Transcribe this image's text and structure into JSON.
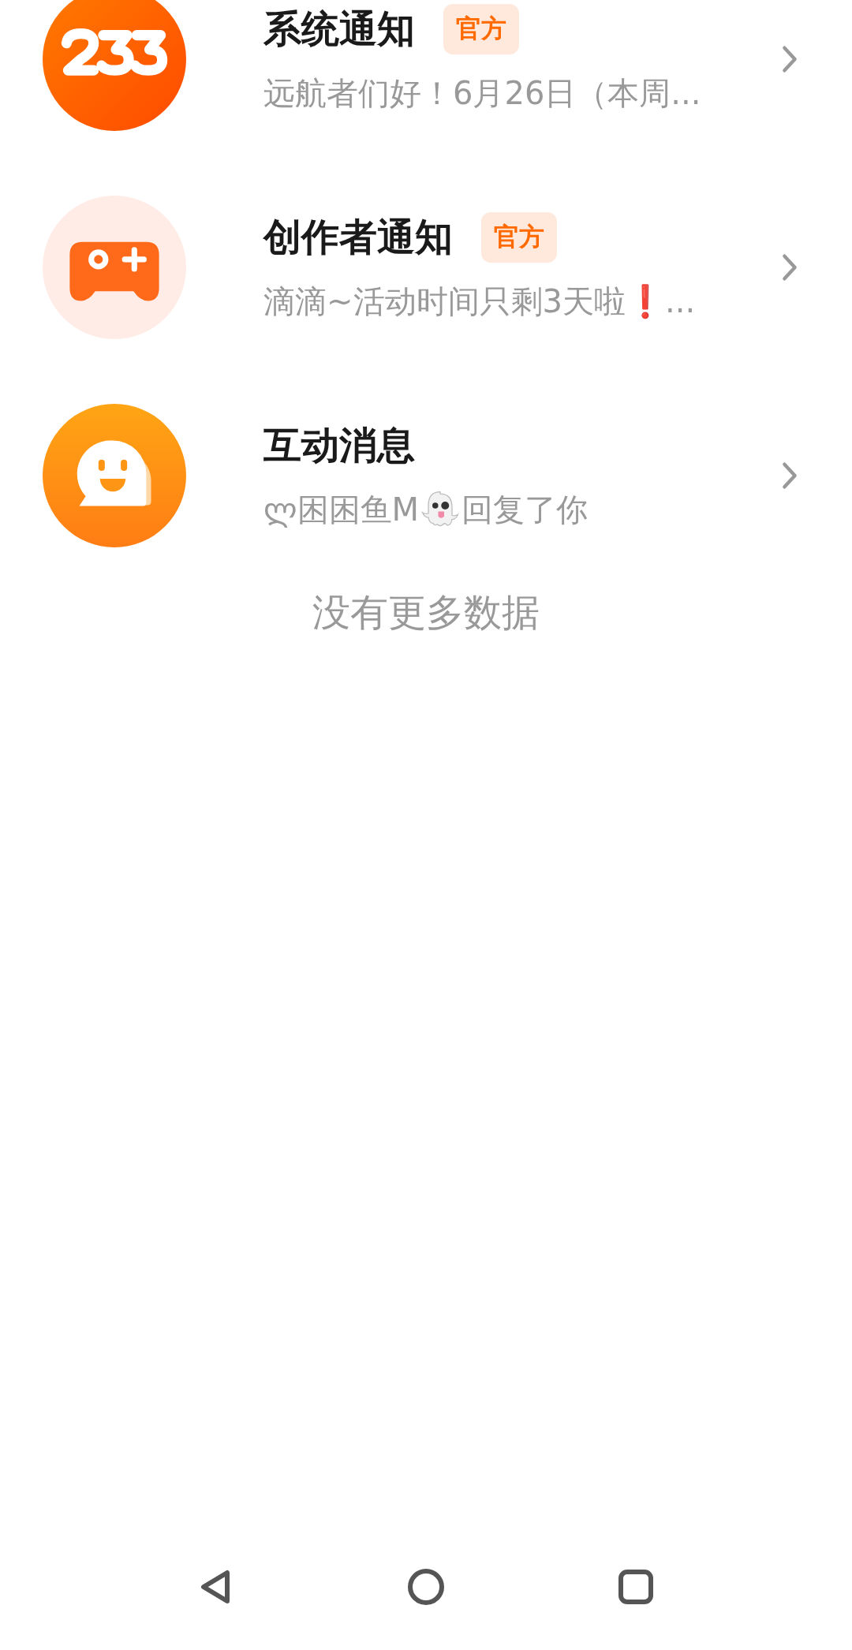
{
  "messages": [
    {
      "kind": "system",
      "title": "系统通知",
      "badge": "官方",
      "preview": [
        {
          "kind": "text",
          "text": "远航者们好！6月26日（本周..."
        }
      ]
    },
    {
      "kind": "creator",
      "title": "创作者通知",
      "badge": "官方",
      "preview": [
        {
          "kind": "text",
          "text": "滴滴~活动时间只剩3天啦❗..."
        }
      ]
    },
    {
      "kind": "interaction",
      "title": "互动消息",
      "preview": [
        {
          "kind": "text",
          "text": "ლ困困鱼M"
        },
        {
          "kind": "ghost"
        },
        {
          "kind": "text",
          "text": "回复了你"
        }
      ]
    }
  ],
  "footer": "没有更多数据"
}
